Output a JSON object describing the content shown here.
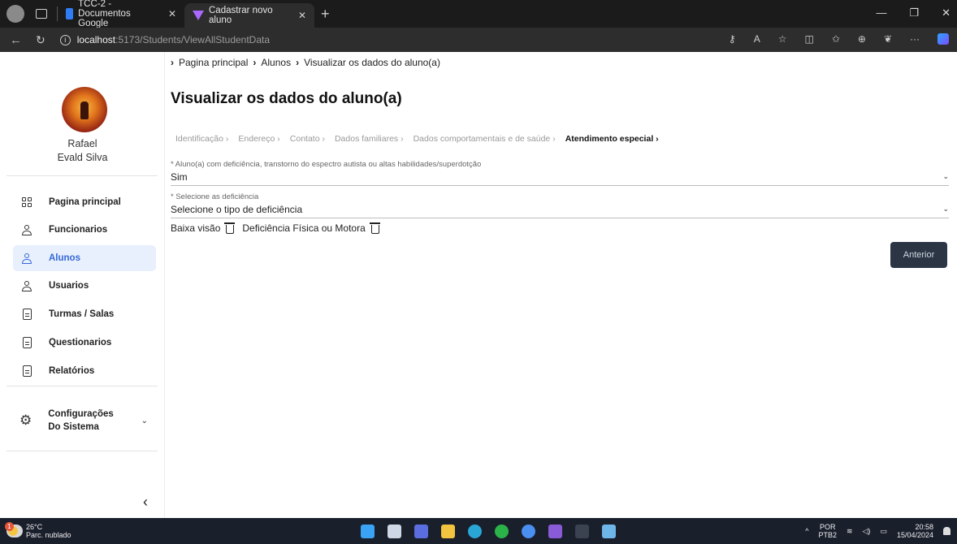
{
  "browser": {
    "tabs": [
      {
        "title": "TCC-2 - Documentos Google",
        "favicon": "google-docs-icon"
      },
      {
        "title": "Cadastrar novo aluno",
        "favicon": "vite-icon"
      }
    ],
    "url_host": "localhost",
    "url_path": ":5173/Students/ViewAllStudentData"
  },
  "sidebar": {
    "user_first": "Rafael",
    "user_last": "Evald Silva",
    "items": [
      {
        "label": "Pagina principal",
        "icon": "grid-icon"
      },
      {
        "label": "Funcionarios",
        "icon": "user-icon"
      },
      {
        "label": "Alunos",
        "icon": "user-icon",
        "active": true
      },
      {
        "label": "Usuarios",
        "icon": "user-icon"
      },
      {
        "label": "Turmas / Salas",
        "icon": "document-icon"
      },
      {
        "label": "Questionarios",
        "icon": "document-icon"
      },
      {
        "label": "Relatórios",
        "icon": "document-icon"
      }
    ],
    "config_label": "Configurações Do Sistema"
  },
  "breadcrumb": [
    "Pagina principal",
    "Alunos",
    "Visualizar os dados do aluno(a)"
  ],
  "page_title": "Visualizar os dados do aluno(a)",
  "steps": [
    "Identificação",
    "Endereço",
    "Contato",
    "Dados familiares",
    "Dados comportamentais e de saúde",
    "Atendimento especial"
  ],
  "current_step": "Atendimento especial",
  "form": {
    "disability_question": "* Aluno(a) com deficiência, transtorno do espectro autista ou altas habilidades/superdotção",
    "disability_value": "Sim",
    "select_label": "* Selecione as deficiência",
    "select_placeholder": "Selecione o tipo de deficiência",
    "selected": [
      "Baixa visão",
      "Deficiência Física ou Motora"
    ]
  },
  "buttons": {
    "previous": "Anterior"
  },
  "taskbar": {
    "temperature": "26°C",
    "weather": "Parc. nublado",
    "weather_badge": "1",
    "lang": "POR",
    "layout": "PTB2",
    "time": "20:58",
    "date": "15/04/2024"
  },
  "colors": {
    "accent": "#3467d6",
    "active_bg": "#e8f0fd",
    "button_bg": "#2b3544"
  }
}
